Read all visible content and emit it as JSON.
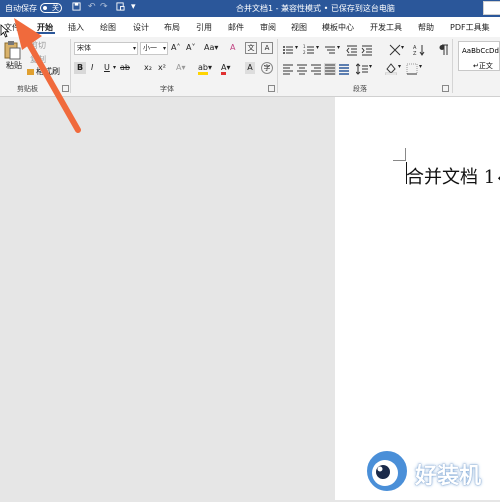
{
  "titlebar": {
    "autosave_label": "自动保存",
    "autosave_state": "关",
    "doc_title": "合并文档1 - 兼容性模式 • 已保存到这台电脑",
    "icons": [
      "save-icon",
      "undo-icon",
      "redo-icon",
      "print-icon",
      "customize-icon"
    ]
  },
  "tabs": [
    "文件",
    "开始",
    "插入",
    "绘图",
    "设计",
    "布局",
    "引用",
    "邮件",
    "审阅",
    "视图",
    "模板中心",
    "开发工具",
    "帮助",
    "PDF工具集"
  ],
  "active_tab": "开始",
  "ribbon": {
    "clipboard": {
      "paste": "粘贴",
      "cut": "剪切",
      "copy": "复制",
      "format_painter": "格式刷",
      "label": "剪贴板"
    },
    "font": {
      "font_name": "宋体",
      "font_size": "小一",
      "label": "字体",
      "bold": "B",
      "italic": "I",
      "underline": "U"
    },
    "paragraph": {
      "label": "段落"
    },
    "styles": {
      "sample": "AaBbCcDd",
      "name": "↵正文"
    }
  },
  "document": {
    "text": "合并文档 1↵"
  },
  "watermark": {
    "text": "好装机"
  },
  "colors": {
    "accent": "#2b579a",
    "arrow": "#f06a3c",
    "highlight": "#ffd400",
    "font_color": "#e03030"
  }
}
